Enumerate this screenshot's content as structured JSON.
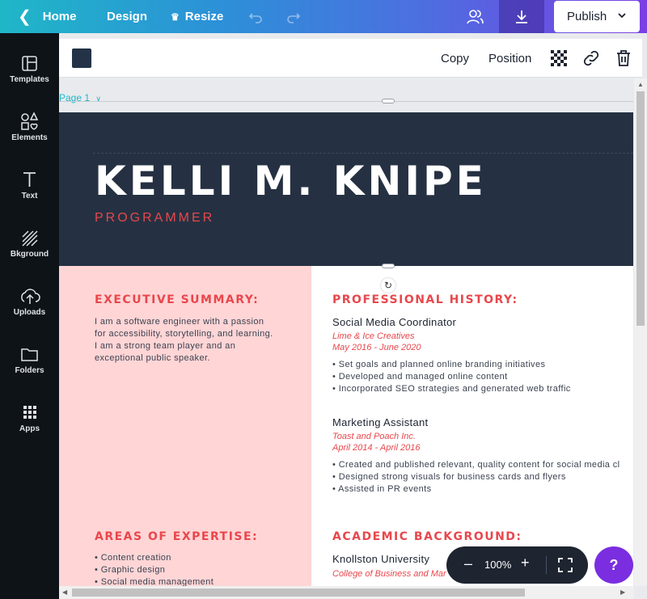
{
  "topbar": {
    "home": "Home",
    "design": "Design",
    "resize": "Resize",
    "publish": "Publish"
  },
  "sidebar": {
    "items": [
      {
        "label": "Templates",
        "icon": "templates-icon"
      },
      {
        "label": "Elements",
        "icon": "elements-icon"
      },
      {
        "label": "Text",
        "icon": "text-icon"
      },
      {
        "label": "Bkground",
        "icon": "background-icon"
      },
      {
        "label": "Uploads",
        "icon": "uploads-icon"
      },
      {
        "label": "Folders",
        "icon": "folders-icon"
      },
      {
        "label": "Apps",
        "icon": "apps-icon"
      }
    ]
  },
  "toolbar": {
    "swatch_color": "#233247",
    "copy": "Copy",
    "position": "Position"
  },
  "canvas": {
    "page_label": "Page 1"
  },
  "resume": {
    "name": "KELLI M. KNIPE",
    "role": "PROGRAMMER",
    "summary_title": "EXECUTIVE SUMMARY:",
    "summary_text": "I am a software engineer with a passion for accessibility, storytelling, and learning. I am a strong team player and an exceptional public speaker.",
    "history_title": "PROFESSIONAL HISTORY:",
    "jobs": [
      {
        "title": "Social Media Coordinator",
        "company": "Lime & Ice Creatives",
        "dates": "May 2016 - June 2020",
        "bullets": [
          "• Set goals and planned online branding initiatives",
          "• Developed and managed online content",
          "• Incorporated SEO strategies and generated web traffic"
        ]
      },
      {
        "title": "Marketing Assistant",
        "company": "Toast and Poach Inc.",
        "dates": "April 2014 - April 2016",
        "bullets": [
          "• Created and published relevant, quality content for social media cl",
          "• Designed strong visuals for business cards and flyers",
          "• Assisted in PR events"
        ]
      }
    ],
    "expertise_title": "AREAS OF EXPERTISE:",
    "expertise": [
      "• Content creation",
      "• Graphic design",
      "• Social media management"
    ],
    "academic_title": "ACADEMIC BACKGROUND:",
    "school": "Knollston University",
    "college": "College of Business and Mar"
  },
  "zoom": {
    "value": "100%",
    "minus": "–",
    "plus": "+"
  },
  "help": "?",
  "colors": {
    "accent": "#e8474c",
    "header_bg": "#253142",
    "left_col_bg": "#ffd5d6"
  }
}
